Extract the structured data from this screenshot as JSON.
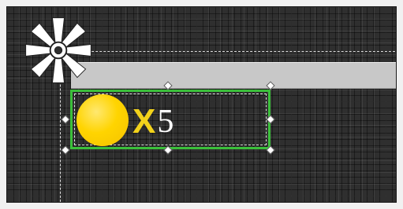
{
  "icons": {
    "star_gear": "gear-icon",
    "coin": "coin-icon"
  },
  "colors": {
    "canvas_background": "#2f2f2f",
    "selection": "#3bbf3b",
    "coin": "#ffd400",
    "multiplier_x": "#f2d21b",
    "multiplier_count": "#ffffff",
    "progress_track": "#c8c8c8"
  },
  "widget": {
    "x_label": "X",
    "count": "5"
  }
}
